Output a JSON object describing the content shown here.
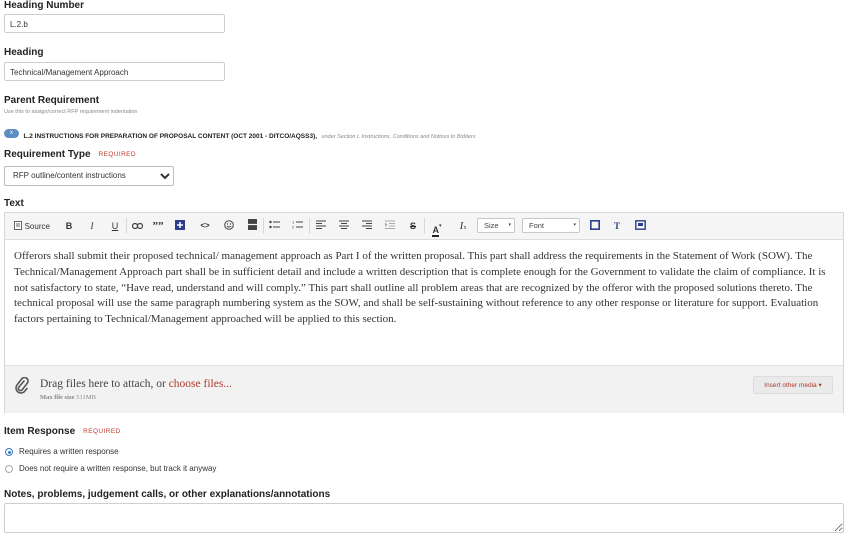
{
  "heading_number": {
    "label": "Heading Number",
    "value": "L.2.b"
  },
  "heading": {
    "label": "Heading",
    "value": "Technical/Management Approach"
  },
  "parent_requirement": {
    "label": "Parent Requirement",
    "hint": "Use this to assign/correct RFP requirement indentation",
    "chip_label": "x",
    "title": "L.2 INSTRUCTIONS FOR PREPARATION OF PROPOSAL CONTENT (OCT 2001 - DITCO/AQSS3),",
    "under": "under Section L Instructions, Conditions and Notices to Bidders"
  },
  "requirement_type": {
    "label": "Requirement Type",
    "required": "REQUIRED",
    "selected": "RFP outline/content instructions"
  },
  "text_field": {
    "label": "Text",
    "toolbar": {
      "source": "Source",
      "bold": "B",
      "italic": "I",
      "underline": "U",
      "blockquote": "””",
      "code": "<>",
      "strike": "S",
      "text_color": "A",
      "clear_format": "I",
      "size": "Size",
      "font": "Font",
      "text_t": "T"
    },
    "content": "Offerors shall submit their proposed technical/ management approach as Part I of the written proposal.  This part shall address the requirements in the Statement of Work (SOW). The Technical/Management Approach part shall be in sufficient detail and include a written description that is complete enough for the Government to validate the claim of compliance.  It is not satisfactory to state, “Have read, understand and will comply.”  This part shall outline all problem areas that are recognized by the offeror with the proposed solutions thereto.  The technical proposal will use the same paragraph numbering system as the SOW, and shall be self-sustaining without reference to any other response or literature for support. Evaluation factors pertaining to Technical/Management approached will be applied to this section.",
    "drop_prefix": "Drag files here to attach, or",
    "choose_files": "choose files...",
    "max_label": "Max file size",
    "max_value": "511MB",
    "insert_media": "Insert other media ▾"
  },
  "item_response": {
    "label": "Item Response",
    "required": "REQUIRED",
    "options": [
      {
        "label": "Requires a written response",
        "selected": true
      },
      {
        "label": "Does not require a written response, but track it anyway",
        "selected": false
      }
    ]
  },
  "notes": {
    "label": "Notes, problems, judgement calls, or other explanations/annotations",
    "value": ""
  },
  "colors": {
    "accent": "#3a78c3",
    "link": "#b03a2e",
    "required": "#c0392b"
  }
}
